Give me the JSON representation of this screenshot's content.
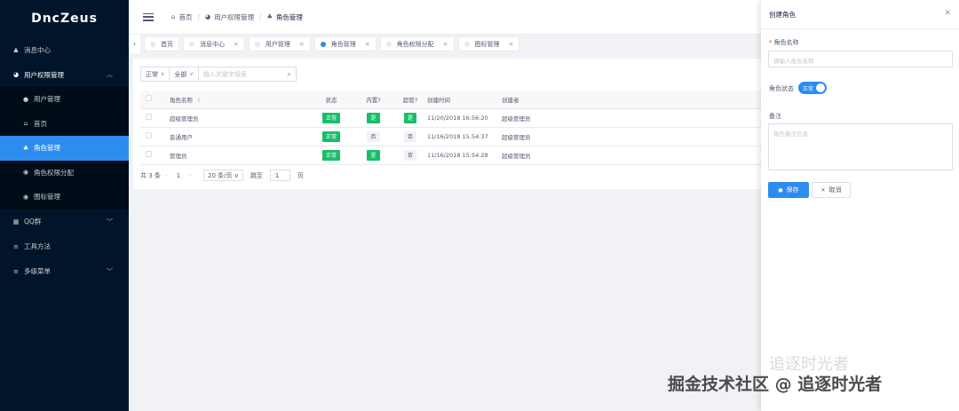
{
  "sidebar": {
    "logo": "DncZeus",
    "items": [
      {
        "label": "消息中心",
        "icon": "bell-icon"
      },
      {
        "label": "用户权限管理",
        "icon": "user-perm-icon",
        "open": true
      },
      {
        "label": "QQ群",
        "icon": "grid-icon"
      },
      {
        "label": "工具方法",
        "icon": "tool-icon"
      },
      {
        "label": "多级菜单",
        "icon": "menu-icon"
      }
    ],
    "submenu": [
      {
        "label": "用户管理",
        "icon": "user-icon"
      },
      {
        "label": "首页",
        "icon": "home-icon"
      },
      {
        "label": "角色管理",
        "icon": "role-icon",
        "active": true
      },
      {
        "label": "角色权限分配",
        "icon": "assign-icon"
      },
      {
        "label": "图标管理",
        "icon": "icon-icon"
      }
    ]
  },
  "header": {
    "breadcrumb": [
      "首页",
      "用户权限管理",
      "角色管理"
    ]
  },
  "tabs": [
    {
      "label": "首页",
      "closable": false,
      "active": false
    },
    {
      "label": "消息中心",
      "closable": true,
      "active": false
    },
    {
      "label": "用户管理",
      "closable": true,
      "active": false
    },
    {
      "label": "角色管理",
      "closable": true,
      "active": true
    },
    {
      "label": "角色权限分配",
      "closable": true,
      "active": false
    },
    {
      "label": "图标管理",
      "closable": true,
      "active": false
    }
  ],
  "filters": {
    "status": "正常",
    "scope": "全部",
    "search_placeholder": "输入关键字搜索"
  },
  "table": {
    "columns": [
      "角色名称",
      "状态",
      "内置?",
      "超管?",
      "创建时间",
      "创建者"
    ],
    "rows": [
      {
        "name": "超级管理员",
        "status": "正常",
        "builtin": "是",
        "superadmin": "是",
        "created": "11/20/2018 16:56:20",
        "creator": "超级管理员"
      },
      {
        "name": "普通用户",
        "status": "正常",
        "builtin": "否",
        "superadmin": "否",
        "created": "11/16/2018 15:54:37",
        "creator": "超级管理员"
      },
      {
        "name": "管理员",
        "status": "正常",
        "builtin": "是",
        "superadmin": "否",
        "created": "11/16/2018 15:54:28",
        "creator": "超级管理员"
      }
    ]
  },
  "pager": {
    "total": "共 3 条",
    "current": "1",
    "page_size": "20 条/页",
    "jump_label": "跳至",
    "jump_value": "1",
    "page_unit": "页"
  },
  "drawer": {
    "title": "创建角色",
    "name_label": "角色名称",
    "name_placeholder": "请输入角色名称",
    "status_label": "角色状态",
    "status_value": "正常",
    "remark_label": "备注",
    "remark_placeholder": "角色备注信息",
    "save": "保存",
    "cancel": "取消"
  },
  "watermark": {
    "line1": "追逐时光者",
    "line2": "掘金技术社区 @ 追逐时光者"
  },
  "colors": {
    "sidebar_bg": "#001529",
    "accent": "#2d8cf0",
    "success": "#19be6b"
  }
}
